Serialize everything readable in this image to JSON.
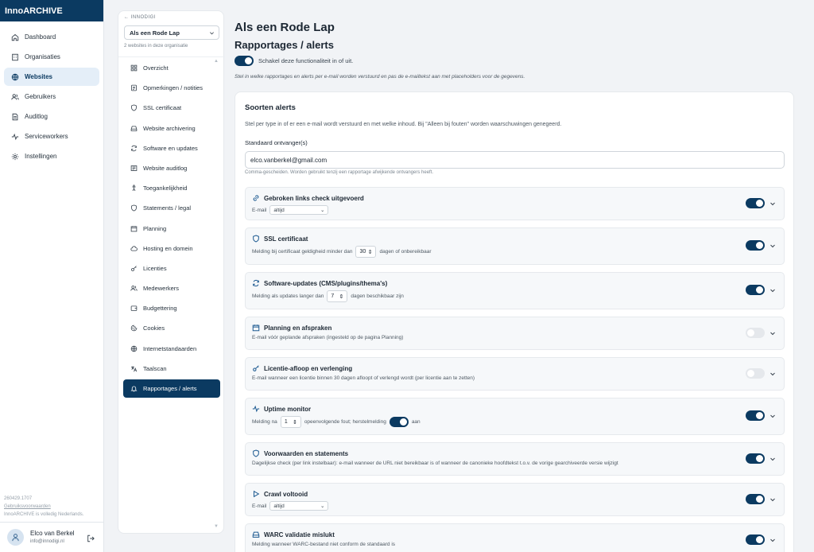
{
  "app": {
    "title": "InnoARCHIVE"
  },
  "sidebar": {
    "items": [
      {
        "label": "Dashboard"
      },
      {
        "label": "Organisaties"
      },
      {
        "label": "Websites"
      },
      {
        "label": "Gebruikers"
      },
      {
        "label": "Auditlog"
      },
      {
        "label": "Serviceworkers"
      },
      {
        "label": "Instellingen"
      }
    ],
    "version": "260429.1707",
    "terms": "Gebruiksvoorwaarden",
    "note": "InnoARCHIVE is volledig Nederlands.",
    "user": {
      "name": "Elco van Berkel",
      "email": "info@innodigi.nl"
    }
  },
  "subnav": {
    "back": "INNODIGI",
    "site": "Als een Rode Lap",
    "note": "2 websites in deze organisatie",
    "items": [
      {
        "label": "Overzicht"
      },
      {
        "label": "Opmerkingen / notities"
      },
      {
        "label": "SSL certificaat"
      },
      {
        "label": "Website archivering"
      },
      {
        "label": "Software en updates"
      },
      {
        "label": "Website auditlog"
      },
      {
        "label": "Toegankelijkheid"
      },
      {
        "label": "Statements / legal"
      },
      {
        "label": "Planning"
      },
      {
        "label": "Hosting en domein"
      },
      {
        "label": "Licenties"
      },
      {
        "label": "Medewerkers"
      },
      {
        "label": "Budgettering"
      },
      {
        "label": "Cookies"
      },
      {
        "label": "Internetstandaarden"
      },
      {
        "label": "Taalscan"
      },
      {
        "label": "Rapportages / alerts"
      }
    ]
  },
  "main": {
    "title": "Als een Rode Lap",
    "subtitle": "Rapportages / alerts",
    "toggle_label": "Schakel deze functionaliteit in of uit.",
    "intro": "Stel in welke rapportages en alerts per e-mail worden verstuurd en pas de e-mailtekst aan met placeholders voor de gegevens.",
    "card": {
      "title": "Soorten alerts",
      "desc": "Stel per type in of er een e-mail wordt verstuurd en met welke inhoud. Bij \"Alleen bij fouten\" worden waarschuwingen genegeerd.",
      "recipient_label": "Standaard ontvanger(s)",
      "recipient_value": "elco.vanberkel@gmail.com",
      "recipient_hint": "Comma-gescheiden. Worden gebruikt tenzij een rapportage afwijkende ontvangers heeft."
    },
    "alerts": [
      {
        "title": "Gebroken links check uitgevoerd",
        "email_label": "E-mail",
        "select": "altijd",
        "enabled": true
      },
      {
        "title": "SSL certificaat",
        "pre": "Melding bij certificaat geldigheid minder dan",
        "num": "30",
        "post": "dagen of onbereikbaar",
        "enabled": true
      },
      {
        "title": "Software-updates (CMS/plugins/thema's)",
        "pre": "Melding als updates langer dan",
        "num": "7",
        "post": "dagen beschikbaar zijn",
        "enabled": true
      },
      {
        "title": "Planning en afspraken",
        "desc": "E-mail vóór geplande afspraken (ingesteld op de pagina Planning)",
        "enabled": false
      },
      {
        "title": "Licentie-afloop en verlenging",
        "desc": "E-mail wanneer een licentie binnen 30 dagen afloopt of verlengd wordt (per licentie aan te zetten)",
        "enabled": false
      },
      {
        "title": "Uptime monitor",
        "pre": "Melding na",
        "num": "1",
        "post": "opeenvolgende fout; herstelmelding",
        "after": "aan",
        "enabled": true
      },
      {
        "title": "Voorwaarden en statements",
        "desc": "Dagelijkse check (per link instelbaar): e-mail wanneer de URL niet bereikbaar is of wanneer de canonieke hoofdtekst t.o.v. de vorige gearchiveerde versie wijzigt",
        "enabled": true
      },
      {
        "title": "Crawl voltooid",
        "email_label": "E-mail",
        "select": "altijd",
        "enabled": true
      },
      {
        "title": "WARC validatie mislukt",
        "desc": "Melding wanneer WARC-bestand niet conform de standaard is",
        "enabled": true
      }
    ]
  },
  "colors": {
    "brand": "#0b3a61",
    "accent": "#0b3a61"
  }
}
